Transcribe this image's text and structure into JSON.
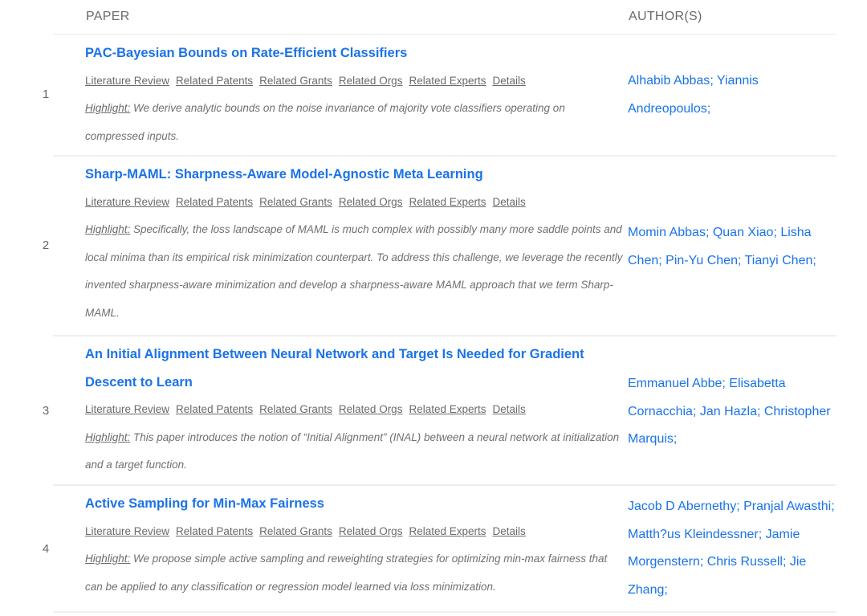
{
  "table": {
    "headers": {
      "paper": "PAPER",
      "authors": "AUTHOR(S)"
    },
    "link_labels": [
      "Literature Review",
      "Related Patents",
      "Related Grants",
      "Related Orgs",
      "Related Experts",
      "Details"
    ],
    "highlight_label": "Highlight:",
    "rows": [
      {
        "index": "1",
        "title": [
          "PAC-Bayesian Bounds on Rate-Efficient Classifiers"
        ],
        "highlight": " We derive analytic bounds on the noise invariance of majority vote classifiers operating on compressed inputs.",
        "authors": [
          "Alhabib Abbas",
          "Yiannis Andreopoulos"
        ]
      },
      {
        "index": "2",
        "title": [
          "Sharp-MAML: Sharpness-Aware Model-Agnostic Meta Learning"
        ],
        "highlight": " Specifically, the loss landscape of MAML is much complex with possibly many more saddle points and local minima than its empirical risk minimization counterpart. To address this challenge, we leverage the recently invented sharpness-aware minimization and develop a sharpness-aware MAML approach that we term Sharp-MAML.",
        "authors": [
          "Momin Abbas",
          "Quan Xiao",
          "Lisha Chen",
          "Pin-Yu Chen",
          "Tianyi Chen"
        ]
      },
      {
        "index": "3",
        "title": [
          "An Initial Alignment Between Neural Network and Target Is Needed for Gradient",
          "Descent to Learn"
        ],
        "highlight": " This paper introduces the notion of “Initial Alignment” (INAL) between a neural network at initialization and a target function.",
        "authors": [
          "Emmanuel Abbe",
          "Elisabetta Cornacchia",
          "Jan Hazla",
          "Christopher Marquis"
        ]
      },
      {
        "index": "4",
        "title": [
          "Active Sampling for Min-Max Fairness"
        ],
        "highlight": " We propose simple active sampling and reweighting strategies for optimizing min-max fairness that can be applied to any classification or regression model learned via loss minimization.",
        "authors": [
          "Jacob D Abernethy",
          "Pranjal Awasthi",
          "Matth?us Kleindessner",
          "Jamie Morgenstern",
          "Chris Russell",
          "Jie Zhang"
        ]
      }
    ]
  },
  "colors": {
    "link_blue": "#1a73e8",
    "text_gray": "#707070"
  }
}
